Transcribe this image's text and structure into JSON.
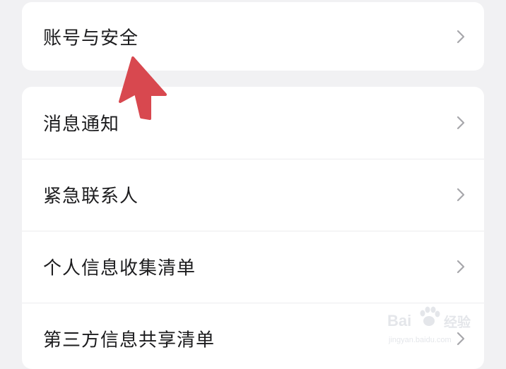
{
  "settings": {
    "group1": [
      {
        "label": "账号与安全"
      }
    ],
    "group2": [
      {
        "label": "消息通知"
      },
      {
        "label": "紧急联系人"
      },
      {
        "label": "个人信息收集清单"
      },
      {
        "label": "第三方信息共享清单"
      }
    ]
  },
  "icons": {
    "row_chevron": "chevron-right-icon",
    "annotation": "red-arrow-pointer"
  },
  "colors": {
    "background": "#f1f1f3",
    "card": "#ffffff",
    "text": "#1c1c1e",
    "chevron": "#a7a7ab",
    "arrow": "#d8484f"
  },
  "watermark": {
    "brand_left": "Bai",
    "brand_right": "经验",
    "url": "jingyan.baidu.com"
  }
}
